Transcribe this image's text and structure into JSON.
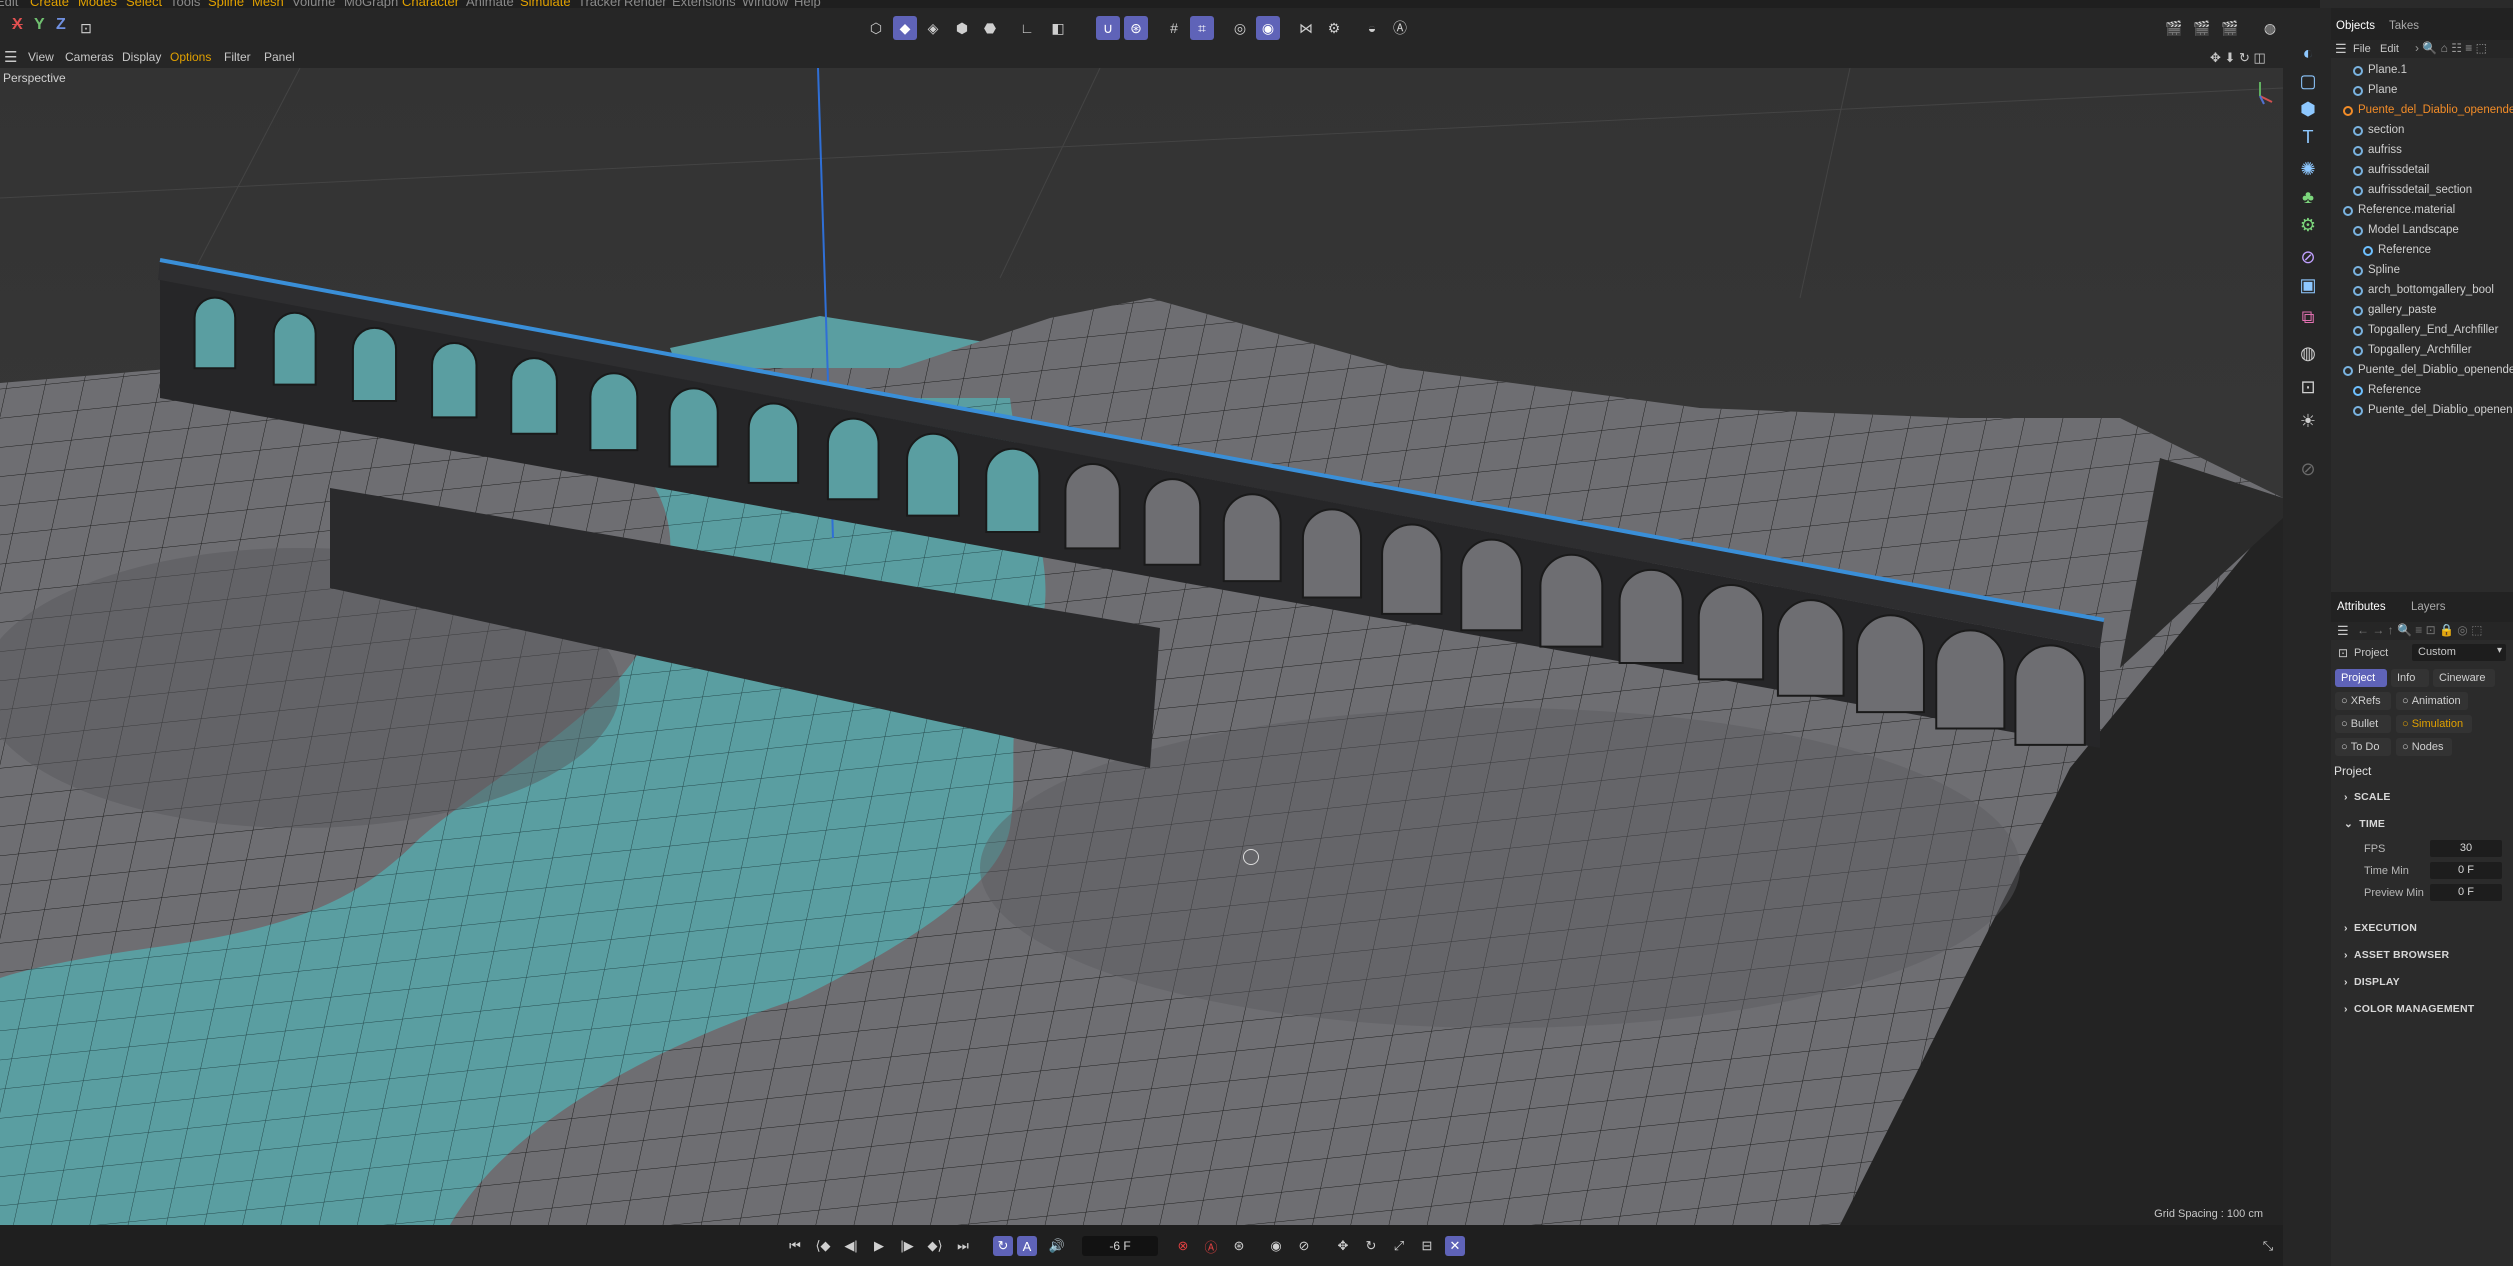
{
  "menu": [
    "Edit",
    "Create",
    "Modes",
    "Select",
    "Tools",
    "Spline",
    "Mesh",
    "Volume",
    "MoGraph",
    "Character",
    "Animate",
    "Simulate",
    "Tracker",
    "Render",
    "Extensions",
    "Window",
    "Help"
  ],
  "axis_lock": [
    "X",
    "Y",
    "Z"
  ],
  "viewport_menu": {
    "items": [
      "View",
      "Cameras",
      "Display",
      "Options",
      "Filter",
      "Panel"
    ],
    "active": "Options"
  },
  "viewport": {
    "camera_label": "Perspective",
    "grid_spacing": "Grid Spacing : 100 cm"
  },
  "timeline": {
    "frame": "-6 F"
  },
  "objects_panel": {
    "tabs": [
      "Objects",
      "Takes"
    ],
    "menu": [
      "File",
      "Edit"
    ],
    "items": [
      {
        "name": "Plane.1",
        "color": "#7ab3e0"
      },
      {
        "name": "Plane",
        "color": "#7ab3e0"
      },
      {
        "name": "Puente_del_Diablio_openended",
        "color": "#f28c28",
        "highlight": true
      },
      {
        "name": "section",
        "color": "#7ab3e0"
      },
      {
        "name": "aufriss",
        "color": "#7ab3e0"
      },
      {
        "name": "aufrissdetail",
        "color": "#7ab3e0"
      },
      {
        "name": "aufrissdetail_section",
        "color": "#7ab3e0"
      },
      {
        "name": "Reference.material",
        "color": "#7ab3e0"
      },
      {
        "name": "Model Landscape",
        "color": "#7ab3e0"
      },
      {
        "name": "Reference",
        "color": "#6ec0ff"
      },
      {
        "name": "Spline",
        "color": "#7ab3e0"
      },
      {
        "name": "arch_bottomgallery_bool",
        "color": "#7ab3e0"
      },
      {
        "name": "gallery_paste",
        "color": "#7ab3e0"
      },
      {
        "name": "Topgallery_End_Archfiller",
        "color": "#7ab3e0"
      },
      {
        "name": "Topgallery_Archfiller",
        "color": "#7ab3e0"
      },
      {
        "name": "Puente_del_Diablio_openended",
        "color": "#7ab3e0"
      },
      {
        "name": "Reference",
        "color": "#6ec0ff"
      },
      {
        "name": "Puente_del_Diablio_openended",
        "color": "#7ab3e0"
      }
    ]
  },
  "attributes_panel": {
    "tabs": [
      "Attributes",
      "Layers"
    ],
    "mode_label": "Project",
    "mode_value": "Custom",
    "buttons": [
      "Project",
      "Info",
      "Cineware",
      "XRefs",
      "Animation",
      "Bullet",
      "Simulation",
      "To Do",
      "Nodes"
    ],
    "selected_button": "Project",
    "title": "Project",
    "sections": {
      "scale": "SCALE",
      "time": "TIME",
      "execution": "EXECUTION",
      "asset_browser": "ASSET BROWSER",
      "display": "DISPLAY",
      "color_management": "COLOR MANAGEMENT"
    },
    "fields": [
      {
        "label": "FPS",
        "value": "30"
      },
      {
        "label": "Time Min",
        "value": "0 F"
      },
      {
        "label": "Preview Min",
        "value": "0 F"
      }
    ]
  }
}
